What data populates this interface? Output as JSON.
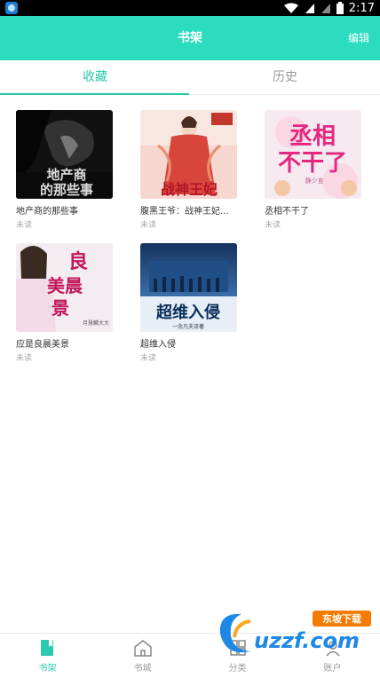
{
  "status": {
    "time": "2:17"
  },
  "header": {
    "title": "书架",
    "edit_label": "编辑"
  },
  "tabs": [
    {
      "label": "收藏"
    },
    {
      "label": "历史"
    }
  ],
  "books": [
    {
      "title": "地产商的那些事",
      "status": "未读",
      "cover_text": "地产商的那些事"
    },
    {
      "title": "腹黑王爷：战神王妃...",
      "status": "未读",
      "cover_text": "战神王妃"
    },
    {
      "title": "丞相不干了",
      "status": "未读",
      "cover_text": "丞相不干了",
      "cover_author": "静少言"
    },
    {
      "title": "应是良晨美景",
      "status": "未读",
      "cover_text": "应是良晨美景",
      "cover_author": "月慧麟大大"
    },
    {
      "title": "超维入侵",
      "status": "未读",
      "cover_text": "超维入侵",
      "cover_author": "一念凡夫流著"
    }
  ],
  "nav": [
    {
      "label": "书架",
      "icon": "book-icon"
    },
    {
      "label": "书城",
      "icon": "house-icon"
    },
    {
      "label": "分类",
      "icon": "category-icon"
    },
    {
      "label": "账户",
      "icon": "account-icon"
    }
  ],
  "watermark": {
    "text": "uzzf.com",
    "badge": "东坡下载"
  },
  "colors": {
    "accent": "#2bdcbf",
    "tab_active": "#2bc9ad"
  }
}
